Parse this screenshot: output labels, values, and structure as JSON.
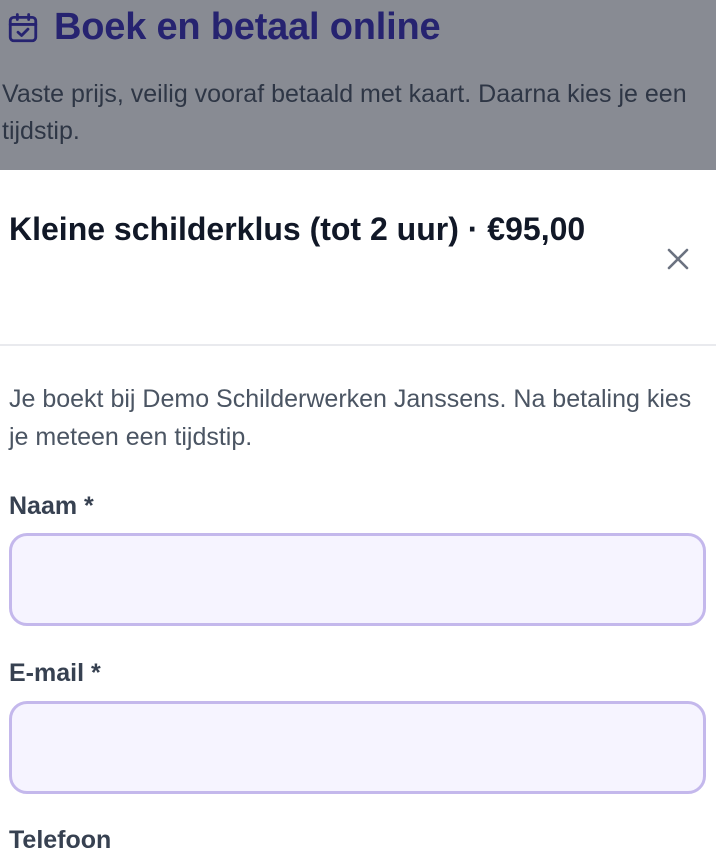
{
  "background_page": {
    "title": "Boek en betaal online",
    "title_icon": "calendar-check-icon",
    "description": "Vaste prijs, veilig vooraf betaald met kaart. Daarna kies je een tijdstip."
  },
  "modal": {
    "title": "Kleine schilderklus (tot 2 uur) · €95,00",
    "close_icon": "close-icon",
    "intro": "Je boekt bij Demo Schilderwerken Janssens. Na betaling kies je meteen een tijdstip.",
    "fields": {
      "name": {
        "label": "Naam *",
        "value": "",
        "placeholder": ""
      },
      "email": {
        "label": "E-mail *",
        "value": "",
        "placeholder": ""
      },
      "phone": {
        "label": "Telefoon"
      }
    }
  },
  "colors": {
    "brand": "#3b2fb8",
    "overlay": "rgba(17,24,39,0.5)",
    "input_border": "#c4b8ec",
    "input_background": "#f6f4ff",
    "heading_text": "#111827",
    "body_text": "#4b5563"
  }
}
